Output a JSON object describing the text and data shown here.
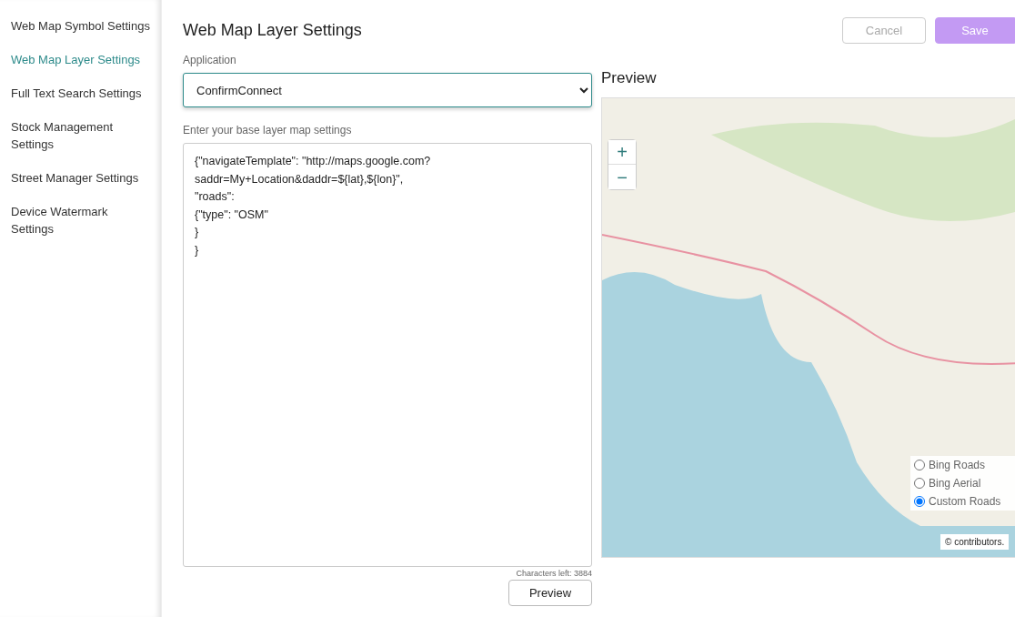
{
  "sidebar": {
    "items": [
      {
        "label": "Web Map Symbol Settings",
        "selected": false
      },
      {
        "label": "Web Map Layer Settings",
        "selected": true
      },
      {
        "label": "Full Text Search Settings",
        "selected": false
      },
      {
        "label": "Stock Management Settings",
        "selected": false
      },
      {
        "label": "Street Manager Settings",
        "selected": false
      },
      {
        "label": "Device Watermark Settings",
        "selected": false
      }
    ]
  },
  "page": {
    "title": "Web Map Layer Settings",
    "buttons": [
      {
        "label": "Cancel",
        "kind": "secondary"
      },
      {
        "label": "Save",
        "kind": "primary"
      }
    ]
  },
  "application": {
    "label": "Application",
    "value": "ConfirmConnect"
  },
  "settings": {
    "label": "Enter your base layer map settings",
    "value": "{\"navigateTemplate\": \"http://maps.google.com?saddr=My+Location&daddr=${lat},${lon}\",\n\"roads\":\n{\"type\": \"OSM\"\n}\n}",
    "counter": "Characters left: 3884",
    "button": "Preview"
  },
  "preview": {
    "title": "Preview",
    "zoom": [
      "+",
      "−"
    ],
    "layers": [
      {
        "label": "Bing Roads",
        "selected": false
      },
      {
        "label": "Bing Aerial",
        "selected": false
      },
      {
        "label": "Custom Roads",
        "selected": true
      }
    ],
    "attribution": "© contributors."
  }
}
